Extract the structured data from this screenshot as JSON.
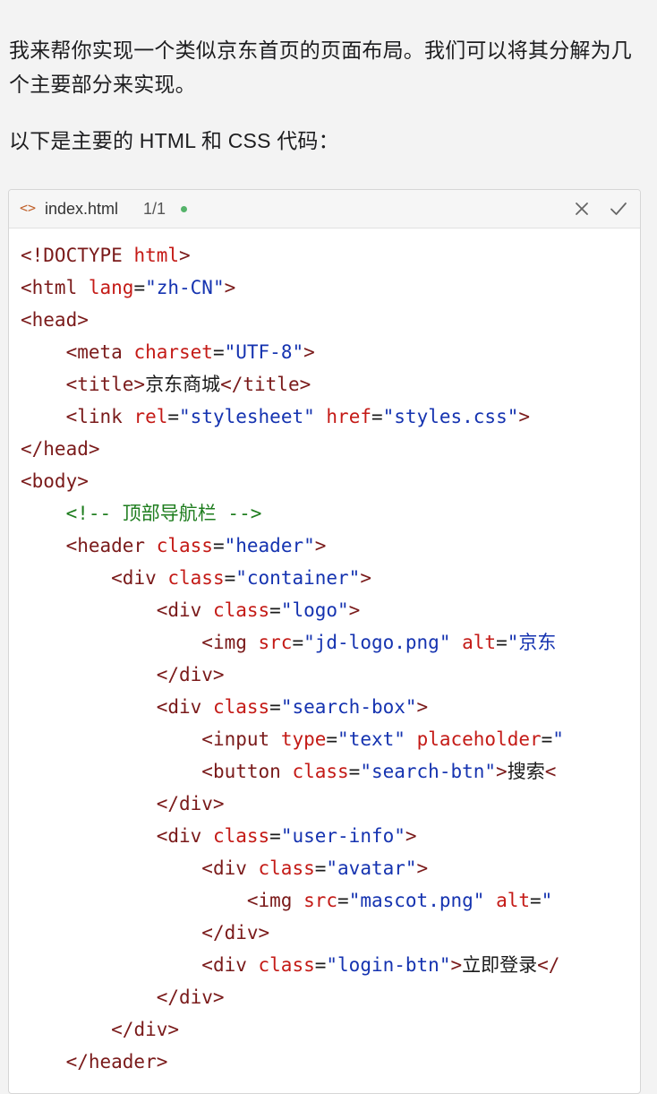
{
  "message": {
    "intro": "我来帮你实现一个类似京东首页的页面布局。我们可以将其分解为几个主要部分来实现。",
    "lead": "以下是主要的 HTML 和 CSS 代码："
  },
  "code_panel": {
    "file_icon": "code-icon",
    "file_name": "index.html",
    "counter": "1/1",
    "status_color": "#55b36a",
    "actions": [
      {
        "name": "close",
        "icon": "close-icon"
      },
      {
        "name": "accept",
        "icon": "check-icon"
      }
    ],
    "lines": [
      {
        "indent": 0,
        "tokens": [
          [
            "t",
            "<!DOCTYPE "
          ],
          [
            "a",
            "html"
          ],
          [
            "t",
            ">"
          ]
        ]
      },
      {
        "indent": 0,
        "tokens": [
          [
            "t",
            "<html "
          ],
          [
            "a",
            "lang"
          ],
          [
            "x",
            "="
          ],
          [
            "v",
            "\"zh-CN\""
          ],
          [
            "t",
            ">"
          ]
        ]
      },
      {
        "indent": 0,
        "tokens": [
          [
            "t",
            "<head>"
          ]
        ]
      },
      {
        "indent": 1,
        "tokens": [
          [
            "t",
            "<meta "
          ],
          [
            "a",
            "charset"
          ],
          [
            "x",
            "="
          ],
          [
            "v",
            "\"UTF-8\""
          ],
          [
            "t",
            ">"
          ]
        ]
      },
      {
        "indent": 1,
        "tokens": [
          [
            "t",
            "<title>"
          ],
          [
            "x",
            "京东商城"
          ],
          [
            "t",
            "</title>"
          ]
        ]
      },
      {
        "indent": 1,
        "tokens": [
          [
            "t",
            "<link "
          ],
          [
            "a",
            "rel"
          ],
          [
            "x",
            "="
          ],
          [
            "v",
            "\"stylesheet\""
          ],
          [
            "x",
            " "
          ],
          [
            "a",
            "href"
          ],
          [
            "x",
            "="
          ],
          [
            "v",
            "\"styles.css\""
          ],
          [
            "t",
            ">"
          ]
        ]
      },
      {
        "indent": 0,
        "tokens": [
          [
            "t",
            "</head>"
          ]
        ]
      },
      {
        "indent": 0,
        "tokens": [
          [
            "t",
            "<body>"
          ]
        ]
      },
      {
        "indent": 1,
        "tokens": [
          [
            "c",
            "<!-- 顶部导航栏 -->"
          ]
        ]
      },
      {
        "indent": 1,
        "tokens": [
          [
            "t",
            "<header "
          ],
          [
            "a",
            "class"
          ],
          [
            "x",
            "="
          ],
          [
            "v",
            "\"header\""
          ],
          [
            "t",
            ">"
          ]
        ]
      },
      {
        "indent": 2,
        "tokens": [
          [
            "t",
            "<div "
          ],
          [
            "a",
            "class"
          ],
          [
            "x",
            "="
          ],
          [
            "v",
            "\"container\""
          ],
          [
            "t",
            ">"
          ]
        ]
      },
      {
        "indent": 3,
        "tokens": [
          [
            "t",
            "<div "
          ],
          [
            "a",
            "class"
          ],
          [
            "x",
            "="
          ],
          [
            "v",
            "\"logo\""
          ],
          [
            "t",
            ">"
          ]
        ]
      },
      {
        "indent": 4,
        "tokens": [
          [
            "t",
            "<img "
          ],
          [
            "a",
            "src"
          ],
          [
            "x",
            "="
          ],
          [
            "v",
            "\"jd-logo.png\""
          ],
          [
            "x",
            " "
          ],
          [
            "a",
            "alt"
          ],
          [
            "x",
            "="
          ],
          [
            "v",
            "\"京东"
          ]
        ]
      },
      {
        "indent": 3,
        "tokens": [
          [
            "t",
            "</div>"
          ]
        ]
      },
      {
        "indent": 3,
        "tokens": [
          [
            "t",
            "<div "
          ],
          [
            "a",
            "class"
          ],
          [
            "x",
            "="
          ],
          [
            "v",
            "\"search-box\""
          ],
          [
            "t",
            ">"
          ]
        ]
      },
      {
        "indent": 4,
        "tokens": [
          [
            "t",
            "<input "
          ],
          [
            "a",
            "type"
          ],
          [
            "x",
            "="
          ],
          [
            "v",
            "\"text\""
          ],
          [
            "x",
            " "
          ],
          [
            "a",
            "placeholder"
          ],
          [
            "x",
            "="
          ],
          [
            "v",
            "\""
          ]
        ]
      },
      {
        "indent": 4,
        "tokens": [
          [
            "t",
            "<button "
          ],
          [
            "a",
            "class"
          ],
          [
            "x",
            "="
          ],
          [
            "v",
            "\"search-btn\""
          ],
          [
            "t",
            ">"
          ],
          [
            "x",
            "搜索"
          ],
          [
            "t",
            "<"
          ]
        ]
      },
      {
        "indent": 3,
        "tokens": [
          [
            "t",
            "</div>"
          ]
        ]
      },
      {
        "indent": 3,
        "tokens": [
          [
            "t",
            "<div "
          ],
          [
            "a",
            "class"
          ],
          [
            "x",
            "="
          ],
          [
            "v",
            "\"user-info\""
          ],
          [
            "t",
            ">"
          ]
        ]
      },
      {
        "indent": 4,
        "tokens": [
          [
            "t",
            "<div "
          ],
          [
            "a",
            "class"
          ],
          [
            "x",
            "="
          ],
          [
            "v",
            "\"avatar\""
          ],
          [
            "t",
            ">"
          ]
        ]
      },
      {
        "indent": 5,
        "tokens": [
          [
            "t",
            "<img "
          ],
          [
            "a",
            "src"
          ],
          [
            "x",
            "="
          ],
          [
            "v",
            "\"mascot.png\""
          ],
          [
            "x",
            " "
          ],
          [
            "a",
            "alt"
          ],
          [
            "x",
            "="
          ],
          [
            "v",
            "\""
          ]
        ]
      },
      {
        "indent": 4,
        "tokens": [
          [
            "t",
            "</div>"
          ]
        ]
      },
      {
        "indent": 4,
        "tokens": [
          [
            "t",
            "<div "
          ],
          [
            "a",
            "class"
          ],
          [
            "x",
            "="
          ],
          [
            "v",
            "\"login-btn\""
          ],
          [
            "t",
            ">"
          ],
          [
            "x",
            "立即登录"
          ],
          [
            "t",
            "</"
          ]
        ]
      },
      {
        "indent": 3,
        "tokens": [
          [
            "t",
            "</div>"
          ]
        ]
      },
      {
        "indent": 2,
        "tokens": [
          [
            "t",
            "</div>"
          ]
        ]
      },
      {
        "indent": 1,
        "tokens": [
          [
            "t",
            "</header>"
          ]
        ]
      }
    ]
  }
}
